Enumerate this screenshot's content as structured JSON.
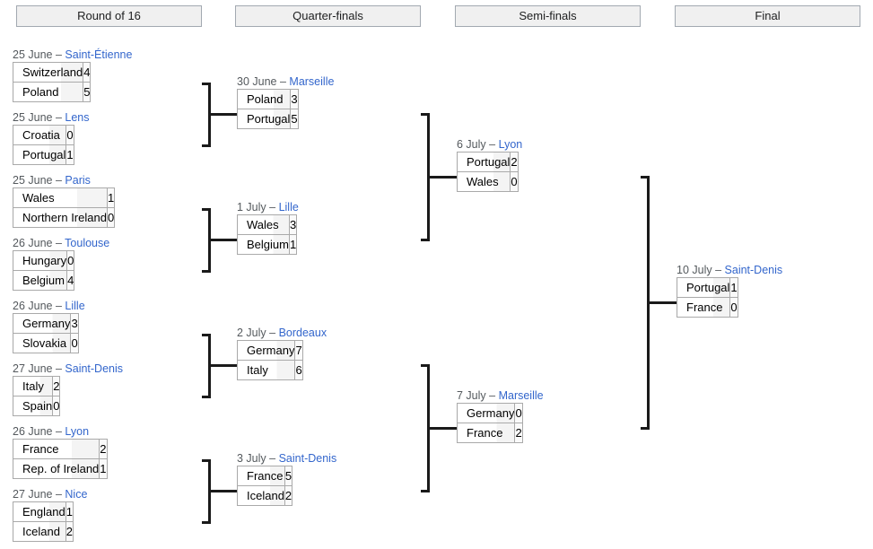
{
  "rounds": [
    {
      "label": "Round of 16"
    },
    {
      "label": "Quarter-finals"
    },
    {
      "label": "Semi-finals"
    },
    {
      "label": "Final"
    }
  ],
  "separator": "–",
  "colors": {
    "venue_link": "#3366cc",
    "date_text": "#54595d",
    "header_fill": "#f0f0f0",
    "header_border": "#a2a9b1",
    "cell_border": "#aaaaaa",
    "connector": "#1a1a1a"
  },
  "matches": {
    "r16_1": {
      "date": "25 June",
      "venue": "Saint-Étienne",
      "team1": "Switzerland",
      "score1": "4",
      "team2": "Poland",
      "score2": "5"
    },
    "r16_2": {
      "date": "25 June",
      "venue": "Lens",
      "team1": "Croatia",
      "score1": "0",
      "team2": "Portugal",
      "score2": "1"
    },
    "r16_3": {
      "date": "25 June",
      "venue": "Paris",
      "team1": "Wales",
      "score1": "1",
      "team2": "Northern Ireland",
      "score2": "0"
    },
    "r16_4": {
      "date": "26 June",
      "venue": "Toulouse",
      "team1": "Hungary",
      "score1": "0",
      "team2": "Belgium",
      "score2": "4"
    },
    "r16_5": {
      "date": "26 June",
      "venue": "Lille",
      "team1": "Germany",
      "score1": "3",
      "team2": "Slovakia",
      "score2": "0"
    },
    "r16_6": {
      "date": "27 June",
      "venue": "Saint-Denis",
      "team1": "Italy",
      "score1": "2",
      "team2": "Spain",
      "score2": "0"
    },
    "r16_7": {
      "date": "26 June",
      "venue": "Lyon",
      "team1": "France",
      "score1": "2",
      "team2": "Rep. of Ireland",
      "score2": "1"
    },
    "r16_8": {
      "date": "27 June",
      "venue": "Nice",
      "team1": "England",
      "score1": "1",
      "team2": "Iceland",
      "score2": "2"
    },
    "qf_1": {
      "date": "30 June",
      "venue": "Marseille",
      "team1": "Poland",
      "score1": "3",
      "team2": "Portugal",
      "score2": "5"
    },
    "qf_2": {
      "date": "1 July",
      "venue": "Lille",
      "team1": "Wales",
      "score1": "3",
      "team2": "Belgium",
      "score2": "1"
    },
    "qf_3": {
      "date": "2 July",
      "venue": "Bordeaux",
      "team1": "Germany",
      "score1": "7",
      "team2": "Italy",
      "score2": "6"
    },
    "qf_4": {
      "date": "3 July",
      "venue": "Saint-Denis",
      "team1": "France",
      "score1": "5",
      "team2": "Iceland",
      "score2": "2"
    },
    "sf_1": {
      "date": "6 July",
      "venue": "Lyon",
      "team1": "Portugal",
      "score1": "2",
      "team2": "Wales",
      "score2": "0"
    },
    "sf_2": {
      "date": "7 July",
      "venue": "Marseille",
      "team1": "Germany",
      "score1": "0",
      "team2": "France",
      "score2": "2"
    },
    "final": {
      "date": "10 July",
      "venue": "Saint-Denis",
      "team1": "Portugal",
      "score1": "1",
      "team2": "France",
      "score2": "0"
    }
  }
}
